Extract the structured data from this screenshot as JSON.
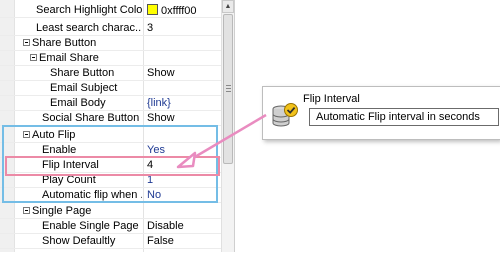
{
  "property_grid": {
    "rows": [
      {
        "name": "Search Highlight Color",
        "value": "0xffff00",
        "indent": 36,
        "kind": "color"
      },
      {
        "name": "Least search charac...",
        "value": "3",
        "indent": 36
      },
      {
        "name": "Share Button",
        "value": "",
        "indent": 20,
        "kind": "category"
      },
      {
        "name": "Email Share",
        "value": "",
        "indent": 28,
        "kind": "category"
      },
      {
        "name": "Share Button",
        "value": "Show",
        "indent": 50
      },
      {
        "name": "Email Subject",
        "value": "",
        "indent": 50
      },
      {
        "name": "Email Body",
        "value": "{link}",
        "indent": 50,
        "kind": "blue"
      },
      {
        "name": "Social Share Button",
        "value": "Show",
        "indent": 42
      },
      {
        "name": "Auto Flip",
        "value": "",
        "indent": 20,
        "kind": "category"
      },
      {
        "name": "Enable",
        "value": "Yes",
        "indent": 42,
        "kind": "blue"
      },
      {
        "name": "Flip Interval",
        "value": "4",
        "indent": 42
      },
      {
        "name": "Play Count",
        "value": "1",
        "indent": 42,
        "kind": "blue"
      },
      {
        "name": "Automatic flip when ...",
        "value": "No",
        "indent": 42,
        "kind": "blue"
      },
      {
        "name": "Single Page",
        "value": "",
        "indent": 20,
        "kind": "category"
      },
      {
        "name": "Enable Single Page",
        "value": "Disable",
        "indent": 42
      },
      {
        "name": "Show Defaultly",
        "value": "False",
        "indent": 42
      }
    ]
  },
  "description_panel": {
    "title": "Flip Interval",
    "text": "Automatic Flip interval in seconds",
    "icon": "database-check-icon"
  },
  "colors": {
    "autoflip_highlight": "#74bde6",
    "flip_interval_highlight": "#ec8aa6",
    "arrow": "#e98cc0",
    "color_swatch": "#ffff00"
  }
}
